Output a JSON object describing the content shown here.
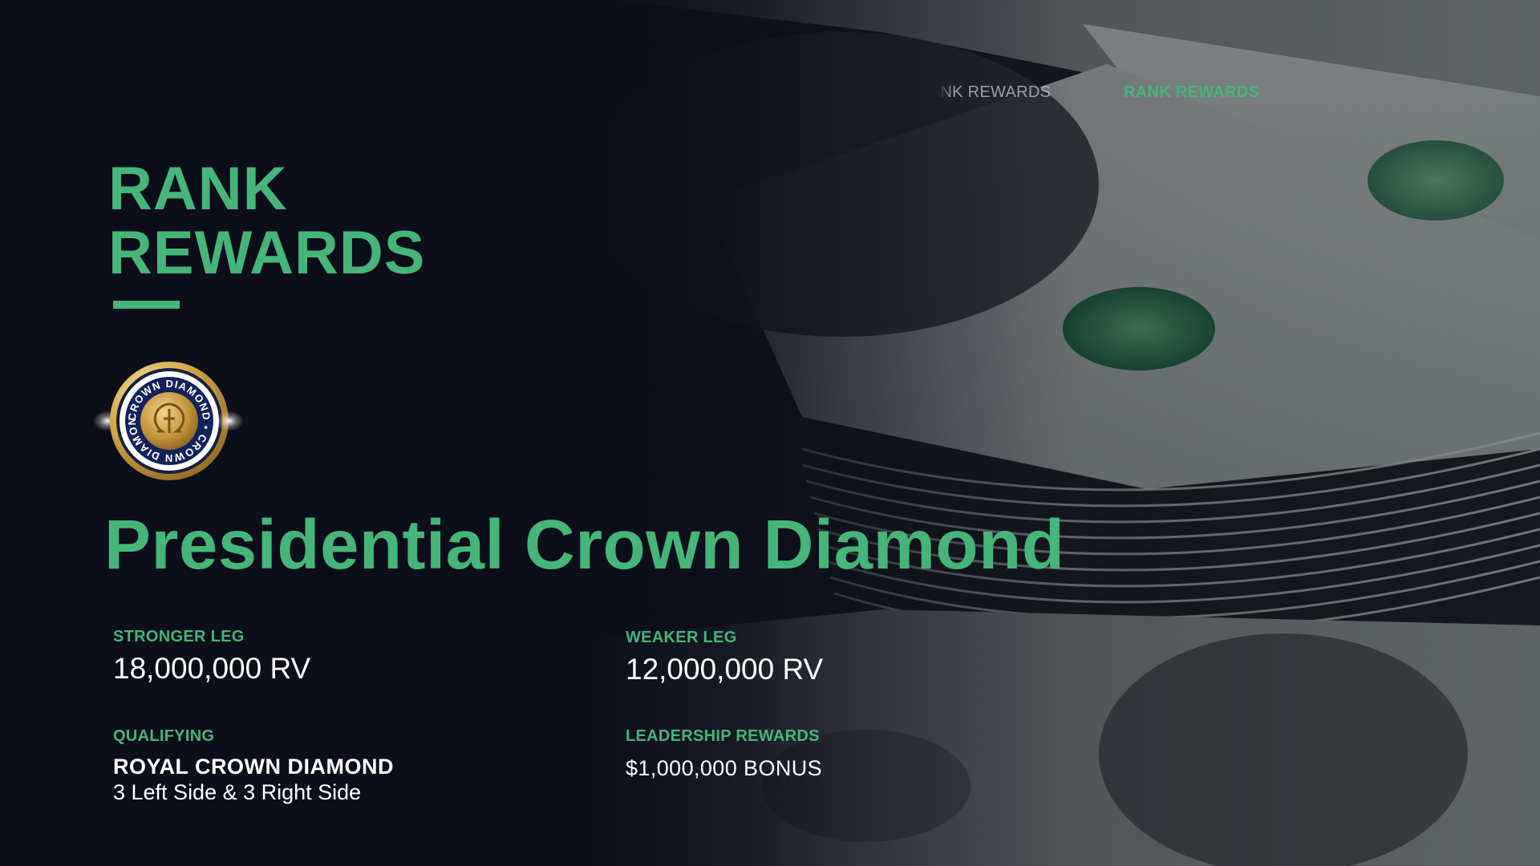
{
  "colors": {
    "accent_green": "#45b57a",
    "background": "#0d0f1a",
    "text_white": "#ffffff",
    "badge_gold": "#c9a24a",
    "badge_navy": "#12235a"
  },
  "nav": {
    "items": [
      {
        "label": "RANK REWARDS",
        "state": "inactive"
      },
      {
        "label": "RANK REWARDS",
        "state": "active"
      }
    ]
  },
  "header": {
    "title_line1": "RANK",
    "title_line2": "REWARDS"
  },
  "badge": {
    "ring_text": "CROWN DIAMOND • CROWN DIAMOND •",
    "icon": "omega-emblem-icon"
  },
  "rank": {
    "name": "Presidential Crown Diamond"
  },
  "details": {
    "stronger_leg": {
      "label": "STRONGER LEG",
      "value": "18,000,000 RV"
    },
    "weaker_leg": {
      "label": "WEAKER LEG",
      "value": "12,000,000 RV"
    },
    "qualifying": {
      "label": "QUALIFYING",
      "value": "ROYAL CROWN DIAMOND",
      "sub": "3 Left Side & 3 Right Side"
    },
    "leadership_rewards": {
      "label": "LEADERSHIP REWARDS",
      "value": "$1,000,000 BONUS"
    }
  }
}
